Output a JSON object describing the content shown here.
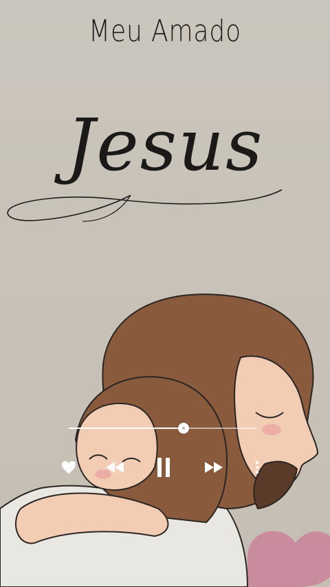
{
  "header": {
    "subtitle": "Meu Amado",
    "title": "Jesus"
  },
  "player": {
    "progress": 0.61,
    "controls": [
      {
        "name": "like-button",
        "icon": "heart-icon"
      },
      {
        "name": "rewind-button",
        "icon": "rewind-icon"
      },
      {
        "name": "pause-button",
        "icon": "pause-icon"
      },
      {
        "name": "fast-forward-button",
        "icon": "fast-forward-icon"
      },
      {
        "name": "more-options-button",
        "icon": "more-vertical-icon"
      }
    ]
  },
  "colors": {
    "background": "#c9c4bb",
    "hair": "#8a5a3c",
    "skin": "#f2cdb4",
    "robe": "#e9e7e2",
    "heart": "#c9849a"
  }
}
